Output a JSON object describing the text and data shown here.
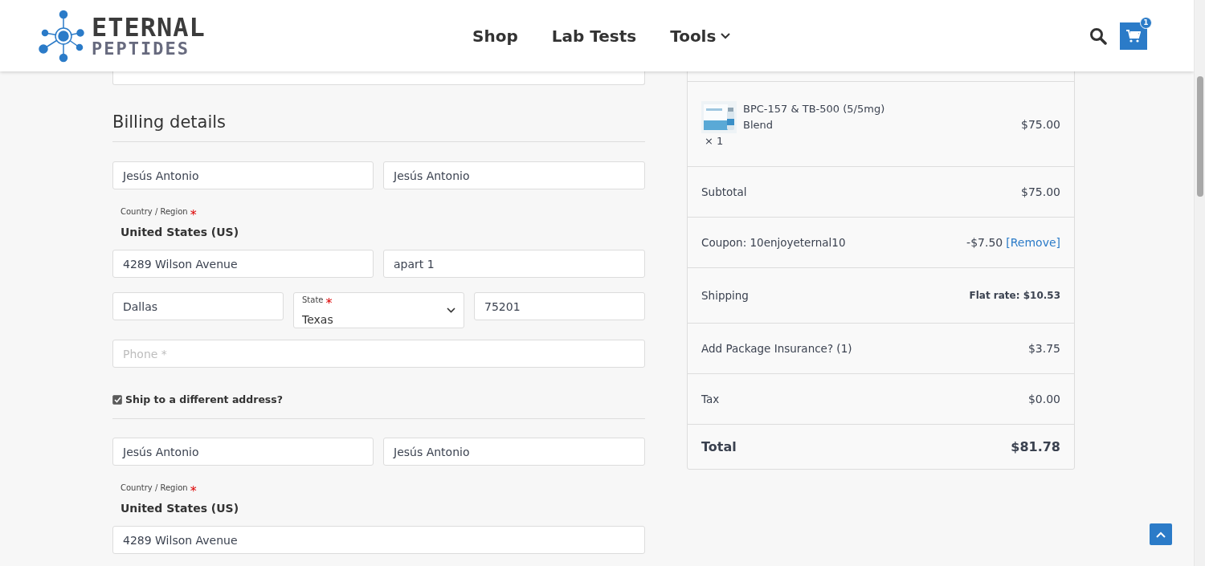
{
  "header": {
    "logo": {
      "line1": "ETERNAL",
      "line2": "PEPTIDES"
    },
    "nav": [
      {
        "label": "Shop",
        "has_dropdown": false
      },
      {
        "label": "Lab Tests",
        "has_dropdown": false
      },
      {
        "label": "Tools",
        "has_dropdown": true
      }
    ],
    "cart_count": "1"
  },
  "billing": {
    "title": "Billing details",
    "first_name": "Jesús Antonio",
    "last_name": "Jesús Antonio",
    "country": {
      "label": "Country / Region",
      "mark": "*",
      "value": "United States (US)"
    },
    "address_1": "4289 Wilson Avenue",
    "address_2": "apart 1",
    "city": "Dallas",
    "state": {
      "label": "State",
      "mark": "*",
      "value": "Texas"
    },
    "postcode": "75201",
    "phone": {
      "placeholder": "Phone *"
    }
  },
  "ship_different": {
    "label": "Ship to a different address?",
    "checked": true
  },
  "shipping": {
    "first_name": "Jesús Antonio",
    "last_name": "Jesús Antonio",
    "country": {
      "label": "Country / Region",
      "mark": "*",
      "value": "United States (US)"
    },
    "address_1": "4289 Wilson Avenue"
  },
  "order": {
    "item": {
      "name": "BPC-157 & TB-500 (5/5mg) Blend",
      "qty": "× 1",
      "price": "$75.00"
    },
    "rows": [
      {
        "kind": "line",
        "label": "Subtotal",
        "value": "$75.00"
      },
      {
        "kind": "coupon",
        "label": "Coupon: 10enjoyeternal10",
        "value": "-$7.50",
        "link": "[Remove]"
      },
      {
        "kind": "shipping",
        "label": "Shipping",
        "value": "Flat rate: $10.53"
      },
      {
        "kind": "line",
        "label": "Add Package Insurance? (1)",
        "value": "$3.75"
      },
      {
        "kind": "line",
        "label": "Tax",
        "value": "$0.00"
      },
      {
        "kind": "total",
        "label": "Total",
        "value": "$81.78"
      }
    ]
  }
}
